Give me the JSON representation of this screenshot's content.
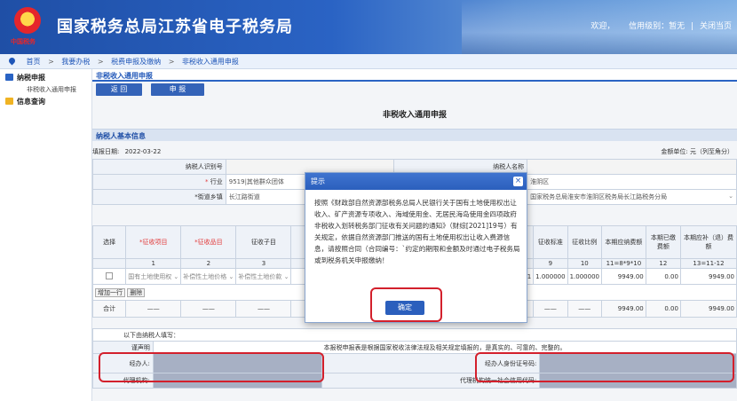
{
  "header": {
    "site_title": "国家税务总局江苏省电子税务局",
    "emblem_sub": "中国税务",
    "welcome": "欢迎，",
    "credit_label": "信用级别：暂无",
    "separator": "|",
    "close_label": "关闭当页"
  },
  "breadcrumb": {
    "items": [
      "首页",
      "我要办税",
      "税费申报及缴纳",
      "非税收入通用申报"
    ],
    "sep": ">"
  },
  "sidebar": {
    "items": [
      {
        "label": "纳税申报",
        "sub": [
          "非税收入通用申报"
        ]
      },
      {
        "label": "信息查询",
        "sub": []
      }
    ]
  },
  "tabs": [
    "非税收入通用申报"
  ],
  "toolbar": {
    "back_label": "返 回",
    "declare_label": "申 报"
  },
  "page_title": "非税收入通用申报",
  "section": {
    "basic_info": "纳税人基本信息"
  },
  "meta": {
    "fill_date_label": "填报日期:",
    "fill_date": "2022-03-22",
    "unit_label": "金额单位: 元（列至角分）"
  },
  "form": {
    "taxpayer_id_label": "纳税人识别号",
    "taxpayer_name_label": "纳税人名称",
    "industry_label": "行业",
    "industry_value": "9519|其他群众团体",
    "district_label": "划",
    "district_value": "淮阴区",
    "street_label": "*街道乡镇",
    "street_value": "长江路街道",
    "authority_label": "关",
    "authority_value": "国家税务总局淮安市淮阴区税务局长江路税务分局"
  },
  "grid": {
    "headers": [
      "选择",
      "*征收项目",
      "*征收品目",
      "征收子目",
      "*",
      "征收标准",
      "征收比例",
      "本期应纳费额",
      "本期已缴费额",
      "本期应补（退）费额"
    ],
    "numbers": [
      "",
      "1",
      "2",
      "3",
      "",
      "9",
      "10",
      "11=8*9*10",
      "12",
      "13=11-12"
    ],
    "row": {
      "item": "国有土地使用权",
      "pinmu": "补偿性土地价格",
      "zimu": "补偿性土地价款",
      "biaozhun": "1.000000",
      "bili": "1.000000",
      "yingna": "9949.00",
      "yijiao": "0.00",
      "yingbu": "9949.00",
      "partial": "1"
    },
    "total_label": "合计",
    "total": {
      "yingna": "9949.00",
      "yijiao": "0.00",
      "yingbu": "9949.00",
      "dash": "——"
    },
    "add_row": "增加一行",
    "del": "删",
    "undo": "除"
  },
  "declaration": {
    "taxpayer_fill": "以下由纳税人填写：",
    "statement_label": "谨声明",
    "statement": "本报税申报表是根据国家税收法律法规及相关规定填报的，是真实的、可靠的、完整的。",
    "agent_label": "经办人:",
    "agent_id_label": "经办人身份证号码:",
    "proxy_label": "代理机构:",
    "proxy_code_label": "代理机构统一社会信用代码:"
  },
  "dialog": {
    "title": "提示",
    "close": "×",
    "message": "按照《财政部自然资源部税务总局人民银行关于国有土地使用权出让收入、矿产资源专项收入、海域使用金、无居民海岛使用金四项政府非税收入划转税务部门征收有关问题的通知》（财综[2021]19号）有关规定，依据自然资源部门推送的国有土地使用权出让收入费源信息，请按照合同（合同编号：`约定的期限和金额及时通过电子税务局或到税务机关申报缴纳！",
    "ok_label": "确定"
  }
}
